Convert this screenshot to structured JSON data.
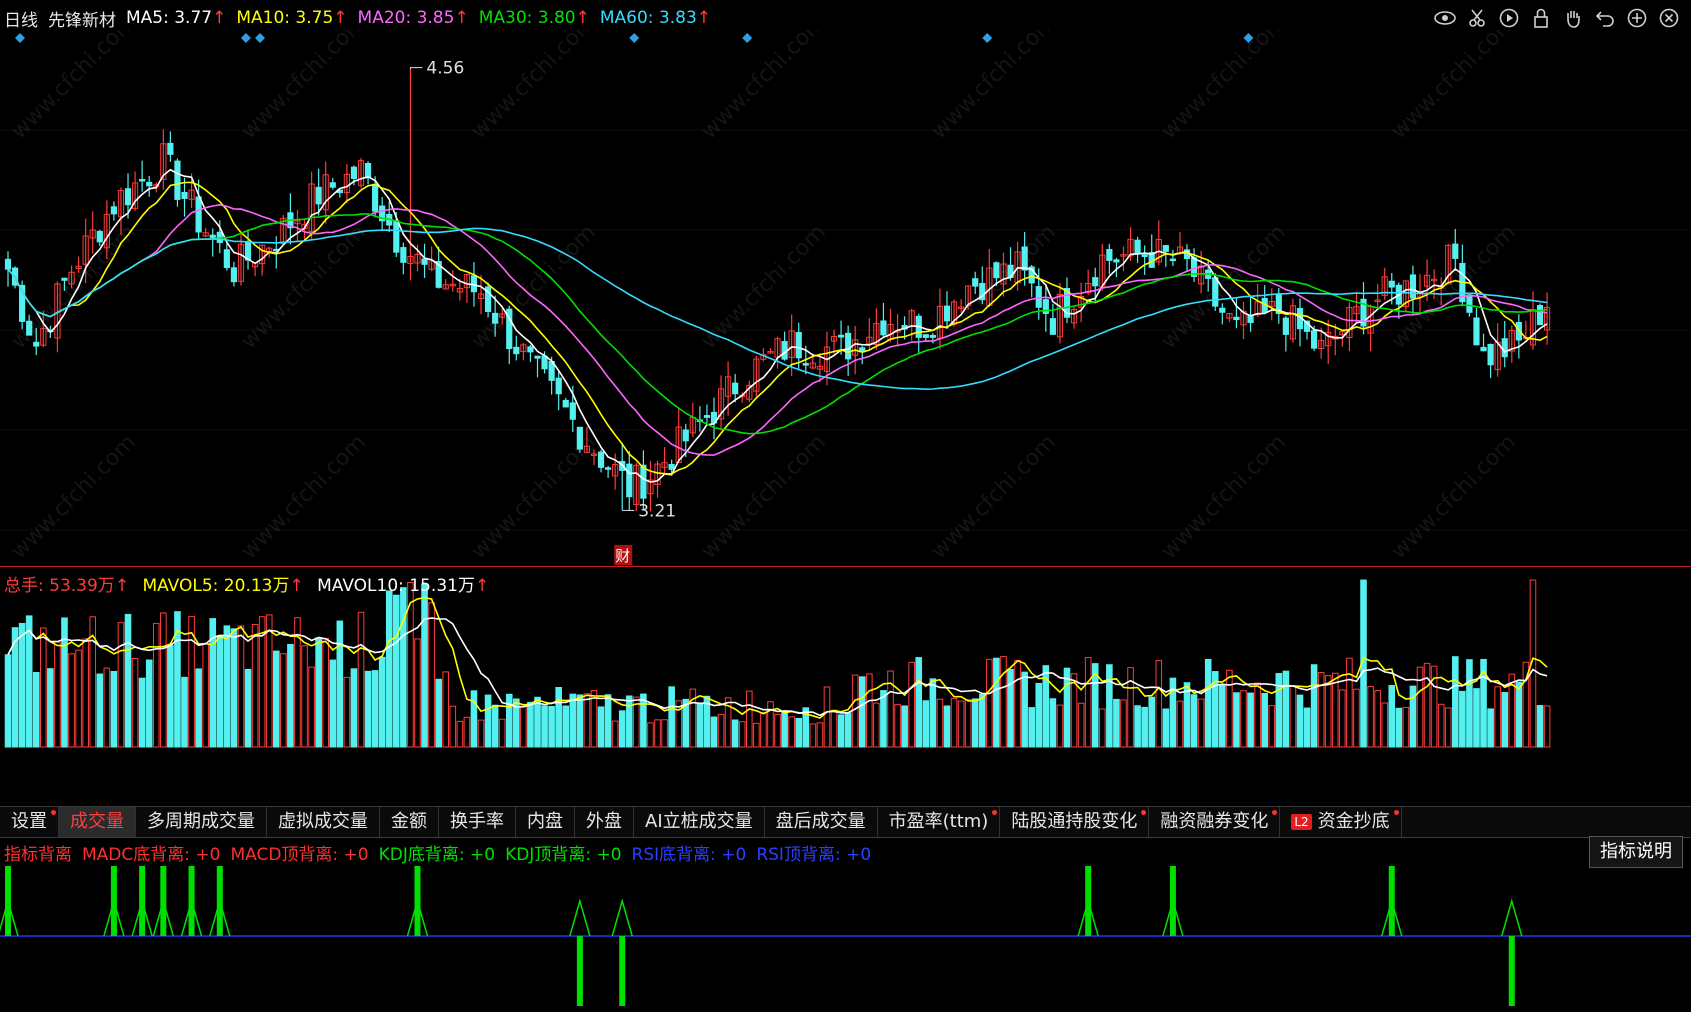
{
  "header": {
    "period": "日线",
    "stock_name": "先锋新材",
    "ma": [
      {
        "label": "MA5: 3.77",
        "color": "#ffffff"
      },
      {
        "label": "MA10: 3.75",
        "color": "#ffff00"
      },
      {
        "label": "MA20: 3.85",
        "color": "#ff66ff"
      },
      {
        "label": "MA30: 3.80",
        "color": "#00e000"
      },
      {
        "label": "MA60: 3.83",
        "color": "#33ddff"
      }
    ],
    "arrow": "↑"
  },
  "toolbar_icons": [
    "eye-icon",
    "scissors-icon",
    "play-icon",
    "lock-icon",
    "hand-icon",
    "undo-icon",
    "zoom-in-icon",
    "close-icon"
  ],
  "price_chart": {
    "high_label": "4.56",
    "low_label": "3.21",
    "event_badge": "财",
    "high": 4.56,
    "low": 3.21,
    "watermark": "www.cfchi.com",
    "colors": {
      "up": "#ff3b3b",
      "down": "#54f0f0",
      "ma5": "#ffffff",
      "ma10": "#ffff00",
      "ma20": "#ff66ff",
      "ma30": "#00e000",
      "ma60": "#33ddff",
      "marker": "#2f9ee6"
    }
  },
  "volume_legend": {
    "total": "总手: 53.39万",
    "mavol5": "MAVOL5: 20.13万",
    "mavol10": "MAVOL10: 15.31万",
    "arrow": "↑"
  },
  "tabs": [
    {
      "label": "设置",
      "dot": true,
      "active": false
    },
    {
      "label": "成交量",
      "dot": false,
      "active": true
    },
    {
      "label": "多周期成交量",
      "dot": false,
      "active": false
    },
    {
      "label": "虚拟成交量",
      "dot": false,
      "active": false
    },
    {
      "label": "金额",
      "dot": false,
      "active": false
    },
    {
      "label": "换手率",
      "dot": false,
      "active": false
    },
    {
      "label": "内盘",
      "dot": false,
      "active": false
    },
    {
      "label": "外盘",
      "dot": false,
      "active": false
    },
    {
      "label": "AI立桩成交量",
      "dot": false,
      "active": false
    },
    {
      "label": "盘后成交量",
      "dot": false,
      "active": false
    },
    {
      "label": "市盈率(ttm)",
      "dot": true,
      "active": false
    },
    {
      "label": "陆股通持股变化",
      "dot": true,
      "active": false
    },
    {
      "label": "融资融券变化",
      "dot": true,
      "active": false
    },
    {
      "label": "资金抄底",
      "dot": true,
      "active": false,
      "badge": "L2"
    }
  ],
  "indicator": {
    "items": [
      {
        "label": "指标背离",
        "color": "#ff3030"
      },
      {
        "label": "MADC底背离: +0",
        "color": "#ff3030"
      },
      {
        "label": "MACD顶背离: +0",
        "color": "#ff3030"
      },
      {
        "label": "KDJ底背离: +0",
        "color": "#00e000"
      },
      {
        "label": "KDJ顶背离: +0",
        "color": "#00e000"
      },
      {
        "label": "RSI底背离: +0",
        "color": "#2a40ff"
      },
      {
        "label": "RSI顶背离: +0",
        "color": "#2a40ff"
      }
    ],
    "help_label": "指标说明"
  }
}
